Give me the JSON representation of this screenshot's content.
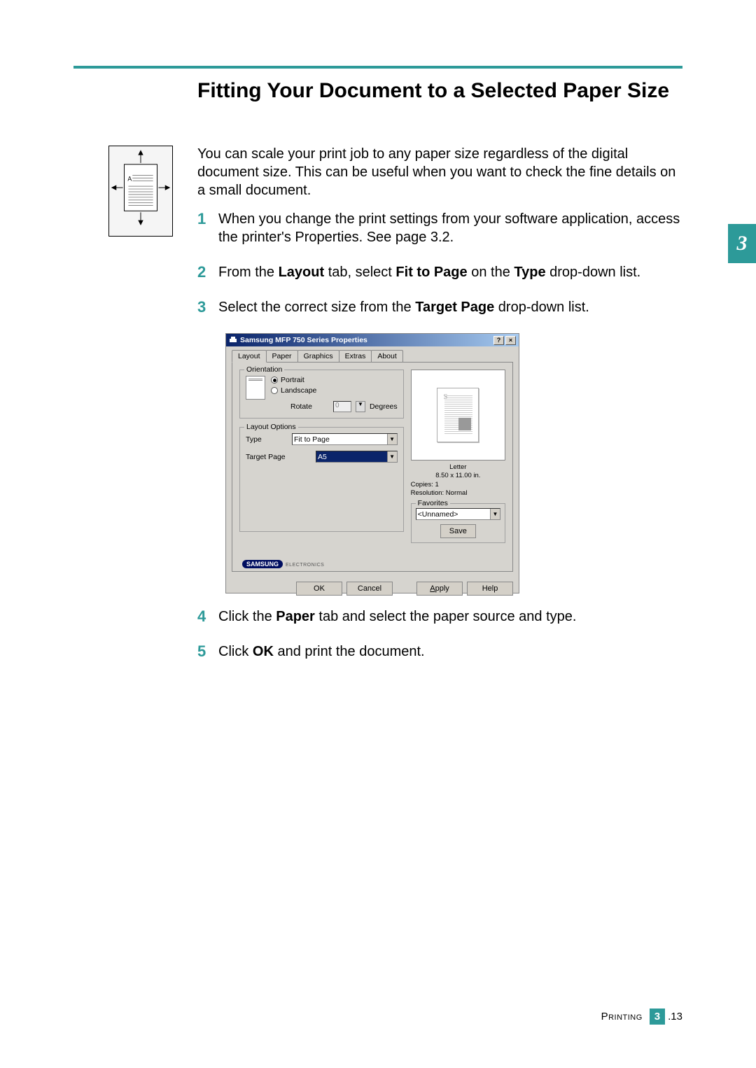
{
  "title": "Fitting Your Document to a Selected Paper Size",
  "intro": "You can scale your print job to any paper size regardless of the digital document size. This can be useful when you want to check the fine details on a small document.",
  "steps": [
    {
      "num": "1",
      "parts": [
        "When you change the print settings from your software application, access the printer's Properties. See page 3.2."
      ]
    },
    {
      "num": "2",
      "parts": [
        "From the ",
        {
          "b": "Layout"
        },
        " tab, select ",
        {
          "b": "Fit to Page"
        },
        " on the ",
        {
          "b": "Type"
        },
        " drop-down list."
      ]
    },
    {
      "num": "3",
      "parts": [
        "Select the correct size from the ",
        {
          "b": "Target Page"
        },
        " drop-down list."
      ]
    },
    {
      "num": "4",
      "parts": [
        "Click the ",
        {
          "b": "Paper"
        },
        " tab and select the paper source and type."
      ]
    },
    {
      "num": "5",
      "parts": [
        "Click ",
        {
          "b": "OK"
        },
        " and print the document."
      ]
    }
  ],
  "dialog": {
    "title": "Samsung MFP 750 Series Properties",
    "tabs": [
      "Layout",
      "Paper",
      "Graphics",
      "Extras",
      "About"
    ],
    "active_tab": "Layout",
    "orientation": {
      "legend": "Orientation",
      "portrait": "Portrait",
      "landscape": "Landscape",
      "selected": "Portrait",
      "rotate_label": "Rotate",
      "rotate_value": "0",
      "degrees": "Degrees"
    },
    "layout_options": {
      "legend": "Layout Options",
      "type_label": "Type",
      "type_value": "Fit to Page",
      "target_label": "Target Page",
      "target_value": "A5"
    },
    "preview": {
      "size_name": "Letter",
      "size_dim": "8.50 x 11.00 in.",
      "copies": "Copies: 1",
      "resolution": "Resolution: Normal"
    },
    "favorites": {
      "legend": "Favorites",
      "value": "<Unnamed>",
      "save": "Save"
    },
    "brand": {
      "name": "SAMSUNG",
      "sub": "ELECTRONICS"
    },
    "buttons": {
      "ok": "OK",
      "cancel": "Cancel",
      "apply": "Apply",
      "help": "Help"
    },
    "titlebar": {
      "help": "?",
      "close": "×"
    }
  },
  "chapter_number": "3",
  "footer": {
    "section": "Printing",
    "chapter": "3",
    "page": ".13"
  }
}
